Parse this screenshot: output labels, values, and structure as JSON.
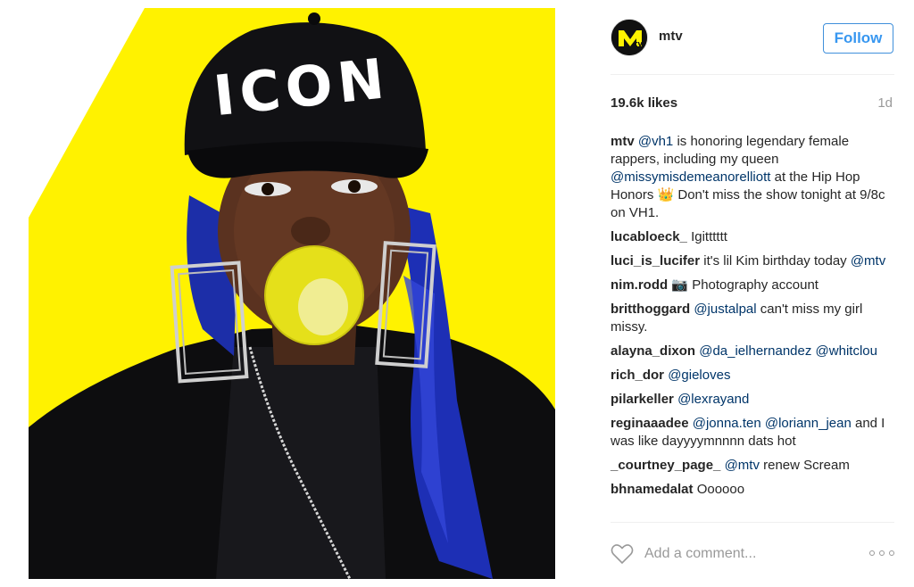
{
  "post": {
    "image_alt": "Woman in a black ICON cap blowing a bubble on a yellow background",
    "cap_text": "ICON"
  },
  "header": {
    "avatar_icon": "mtv-logo-icon",
    "username": "mtv",
    "follow_label": "Follow"
  },
  "stats": {
    "likes": "19.6k likes",
    "age": "1d"
  },
  "caption": {
    "user": "mtv",
    "parts": [
      {
        "type": "mention",
        "text": "@vh1"
      },
      {
        "type": "text",
        "text": " is honoring legendary female rappers, including my queen "
      },
      {
        "type": "mention",
        "text": "@missymisdemeanorelliott"
      },
      {
        "type": "text",
        "text": " at the Hip Hop Honors 👑 Don't miss the show tonight at 9/8c on VH1."
      }
    ]
  },
  "comments": [
    {
      "user": "lucabloeck_",
      "parts": [
        {
          "type": "text",
          "text": "Igitttttt"
        }
      ]
    },
    {
      "user": "luci_is_lucifer",
      "parts": [
        {
          "type": "text",
          "text": "it's lil Kim birthday today "
        },
        {
          "type": "mention",
          "text": "@mtv"
        }
      ]
    },
    {
      "user": "nim.rodd",
      "parts": [
        {
          "type": "text",
          "text": "📷 Photography account"
        }
      ]
    },
    {
      "user": "britthoggard",
      "parts": [
        {
          "type": "mention",
          "text": "@justalpal"
        },
        {
          "type": "text",
          "text": " can't miss my girl missy."
        }
      ]
    },
    {
      "user": "alayna_dixon",
      "parts": [
        {
          "type": "mention",
          "text": "@da_ielhernandez"
        },
        {
          "type": "text",
          "text": " "
        },
        {
          "type": "mention",
          "text": "@whitclou"
        }
      ]
    },
    {
      "user": "rich_dor",
      "parts": [
        {
          "type": "mention",
          "text": "@gieloves"
        }
      ]
    },
    {
      "user": "pilarkeller",
      "parts": [
        {
          "type": "mention",
          "text": "@lexrayand"
        }
      ]
    },
    {
      "user": "reginaaadee",
      "parts": [
        {
          "type": "mention",
          "text": "@jonna.ten"
        },
        {
          "type": "text",
          "text": " "
        },
        {
          "type": "mention",
          "text": "@loriann_jean"
        },
        {
          "type": "text",
          "text": " and I was like dayyyymnnnn dats hot"
        }
      ]
    },
    {
      "user": "_courtney_page_",
      "parts": [
        {
          "type": "mention",
          "text": "@mtv"
        },
        {
          "type": "text",
          "text": " renew Scream"
        }
      ]
    },
    {
      "user": "bhnamedalat",
      "parts": [
        {
          "type": "text",
          "text": "Oooooo"
        }
      ]
    }
  ],
  "comment_box": {
    "placeholder": "Add a comment...",
    "like_icon": "heart-icon",
    "more_icon": "more-options-icon"
  },
  "colors": {
    "yellow": "#FFF200",
    "link": "#003569",
    "follow": "#3897f0"
  }
}
